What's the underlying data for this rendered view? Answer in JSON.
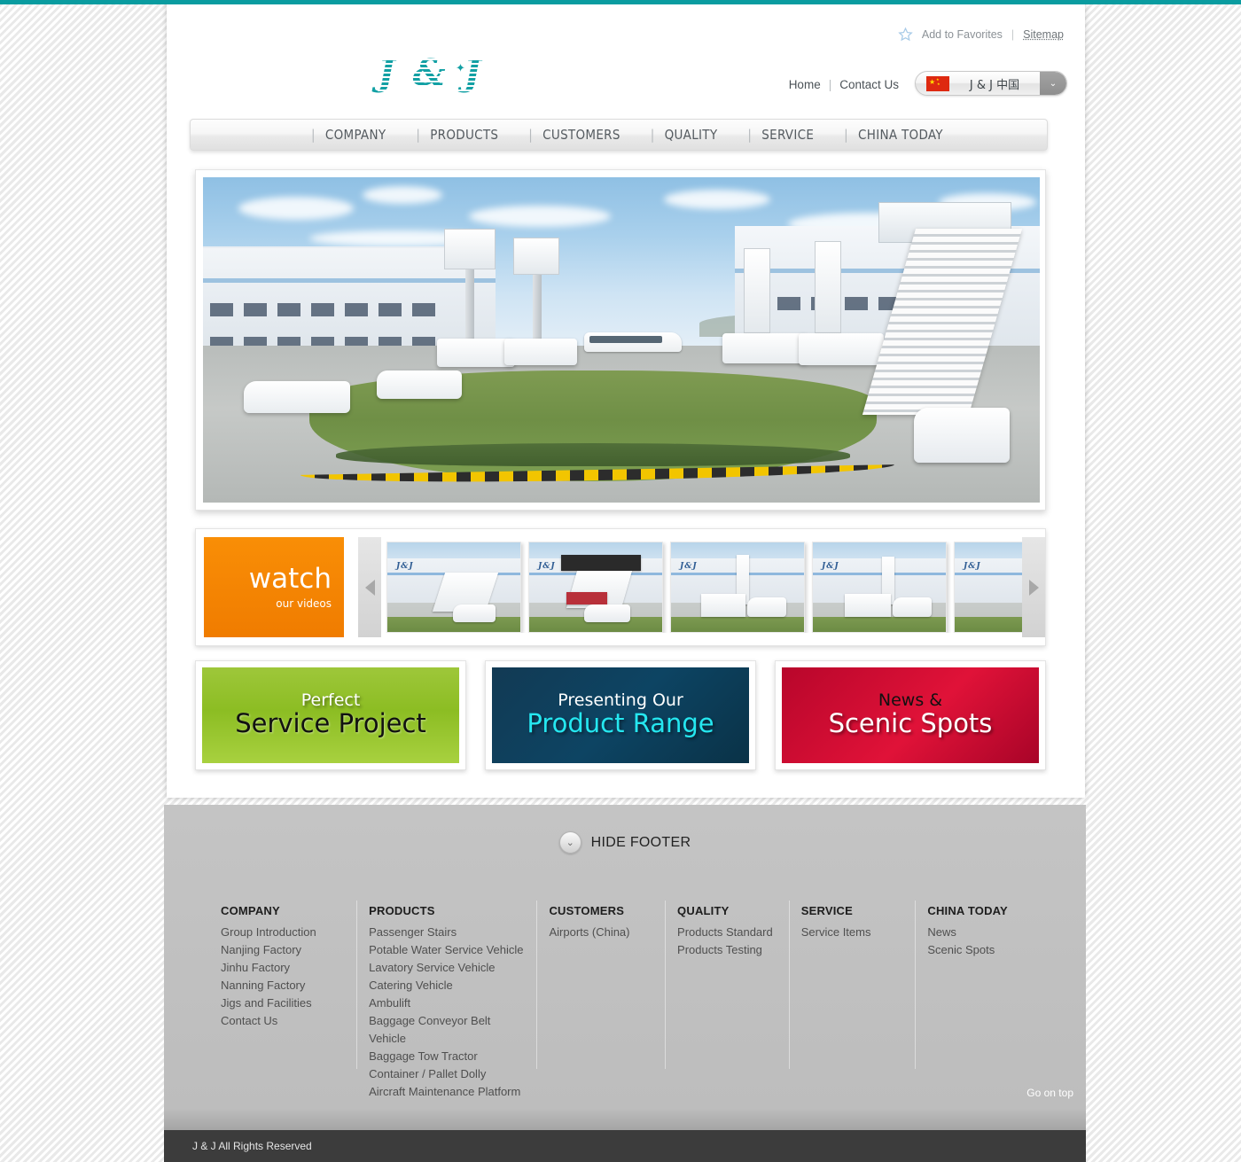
{
  "theme": {
    "teal": "#0a9ca0",
    "orange": "#f58a00",
    "green": "#8cbd23",
    "blue": "#0d4463",
    "red": "#e01238",
    "cyan": "#25e7f0"
  },
  "topbar": {
    "color": "#0a9ca0"
  },
  "utility": {
    "add_to_favorites": "Add to Favorites",
    "divider": "|",
    "sitemap": "Sitemap",
    "star_icon": "star-icon"
  },
  "logo": {
    "text": "J & J",
    "spark": "✦"
  },
  "toplinks": {
    "home": "Home",
    "divider": "|",
    "contact": "Contact Us"
  },
  "language": {
    "label": "J & J 中国",
    "flag": "china-flag",
    "caret": "⌄"
  },
  "mainnav": {
    "separator": "|",
    "items": [
      {
        "label": "COMPANY"
      },
      {
        "label": "PRODUCTS"
      },
      {
        "label": "CUSTOMERS"
      },
      {
        "label": "QUALITY"
      },
      {
        "label": "SERVICE"
      },
      {
        "label": "CHINA TODAY"
      }
    ]
  },
  "hero": {
    "alt": "J & J airport ground support equipment yard with passenger stairs, catering vehicles and a coach in front of factory buildings"
  },
  "carousel": {
    "watch_main": "watch",
    "watch_sub": "our videos",
    "prev_arrow": "chevron-left-icon",
    "next_arrow": "chevron-right-icon",
    "thumbnails": [
      {
        "alt": "Passenger stairs vehicle",
        "logo": "J&J"
      },
      {
        "alt": "Covered passenger stairs with red trim",
        "logo": "J&J"
      },
      {
        "alt": "Catering vehicle with raised platform",
        "logo": "J&J"
      },
      {
        "alt": "Catering vehicle side view",
        "logo": "J&J"
      },
      {
        "alt": "Factory building with vehicle",
        "logo": "J&J"
      }
    ]
  },
  "promos": [
    {
      "small": "Perfect",
      "big": "Service Project",
      "style": "green"
    },
    {
      "small": "Presenting Our",
      "big": "Product Range",
      "style": "blue"
    },
    {
      "small": "News &",
      "big": "Scenic Spots",
      "style": "red"
    }
  ],
  "footer": {
    "hide_footer_label": "HIDE FOOTER",
    "hide_footer_icon": "chevron-down-icon",
    "go_on_top": "Go on top",
    "copyright": "J & J All Rights Reserved",
    "columns": [
      {
        "title": "COMPANY",
        "links": [
          "Group Introduction",
          "Nanjing Factory",
          "Jinhu Factory",
          "Nanning Factory",
          "Jigs and Facilities",
          "Contact Us"
        ]
      },
      {
        "title": "PRODUCTS",
        "links": [
          "Passenger Stairs",
          "Potable Water Service Vehicle",
          "Lavatory Service Vehicle",
          "Catering Vehicle",
          "Ambulift",
          "Baggage Conveyor Belt Vehicle",
          "Baggage Tow Tractor",
          "Container / Pallet Dolly",
          "Aircraft Maintenance Platform"
        ]
      },
      {
        "title": "CUSTOMERS",
        "links": [
          "Airports (China)"
        ]
      },
      {
        "title": "QUALITY",
        "links": [
          "Products Standard",
          "Products Testing"
        ]
      },
      {
        "title": "SERVICE",
        "links": [
          "Service Items"
        ]
      },
      {
        "title": "CHINA TODAY",
        "links": [
          "News",
          "Scenic Spots"
        ]
      }
    ]
  }
}
